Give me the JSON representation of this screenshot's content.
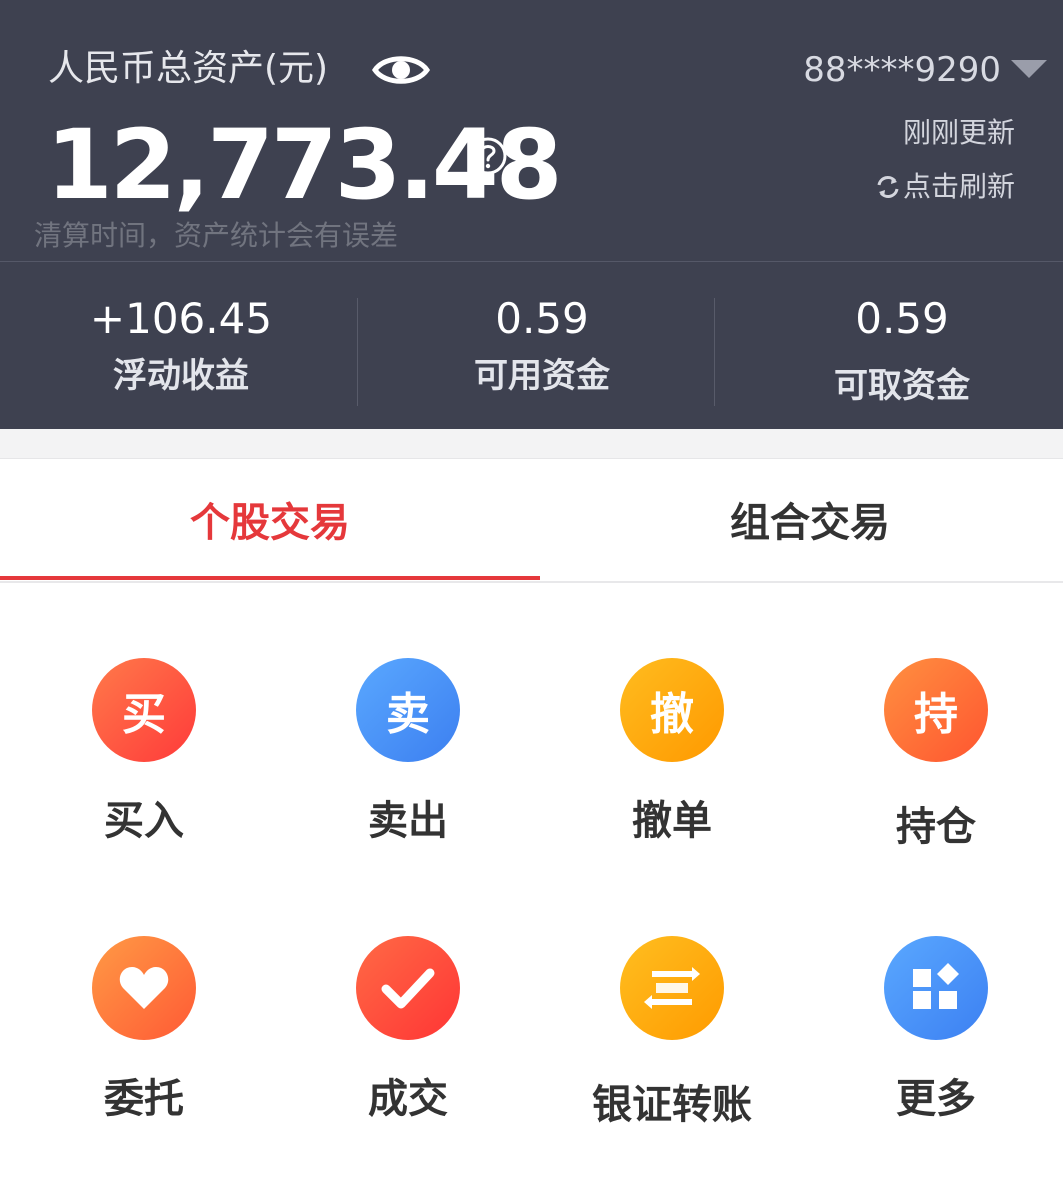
{
  "header": {
    "asset_title": "人民币总资产(元)",
    "account": "88****9290",
    "total_assets": "12,773.48",
    "update_status": "刚刚更新",
    "refresh_label": "点击刷新",
    "notice": "清算时间，资产统计会有误差",
    "stats": [
      {
        "value": "+106.45",
        "label": "浮动收益"
      },
      {
        "value": "0.59",
        "label": "可用资金"
      },
      {
        "value": "0.59",
        "label": "可取资金"
      }
    ]
  },
  "tabs": [
    {
      "label": "个股交易",
      "active": true
    },
    {
      "label": "组合交易",
      "active": false
    }
  ],
  "actions": [
    {
      "label": "买入",
      "glyph": "买",
      "icon": "buy-icon",
      "color": "#ff5740"
    },
    {
      "label": "卖出",
      "glyph": "卖",
      "icon": "sell-icon",
      "color": "#4a90f7"
    },
    {
      "label": "撤单",
      "glyph": "撤",
      "icon": "cancel-order-icon",
      "color": "#ffa60f"
    },
    {
      "label": "持仓",
      "glyph": "持",
      "icon": "position-icon",
      "color": "#ff7033"
    },
    {
      "label": "委托",
      "glyph": "",
      "icon": "heart-icon",
      "color": "#ff7238"
    },
    {
      "label": "成交",
      "glyph": "",
      "icon": "checkmark-icon",
      "color": "#ff4a40"
    },
    {
      "label": "银证转账",
      "glyph": "",
      "icon": "transfer-icon",
      "color": "#ffa80f"
    },
    {
      "label": "更多",
      "glyph": "",
      "icon": "more-grid-icon",
      "color": "#4a8ff7"
    }
  ]
}
